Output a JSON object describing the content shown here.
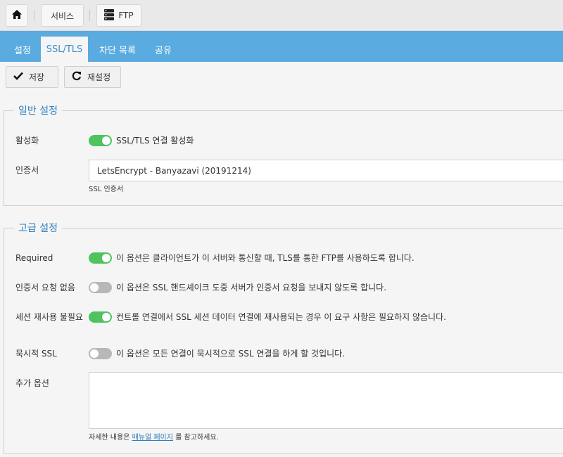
{
  "breadcrumb": {
    "services": "서비스",
    "ftp": "FTP"
  },
  "tabs": [
    "설정",
    "SSL/TLS",
    "차단 목록",
    "공유"
  ],
  "toolbar": {
    "save": "저장",
    "reset": "재설정"
  },
  "general": {
    "legend": "일반 설정",
    "enable_label": "활성화",
    "enable_text": "SSL/TLS 연결 활성화",
    "enable_on": true,
    "cert_label": "인증서",
    "cert_value": "LetsEncrypt - Banyazavi (20191214)",
    "cert_help": "SSL 인증서"
  },
  "advanced": {
    "legend": "고급 설정",
    "options": [
      {
        "label": "Required",
        "text": "이 옵션은 클라이언트가 이 서버와 통신할 때, TLS를 통한 FTP를 사용하도록 합니다.",
        "on": true
      },
      {
        "label": "인증서 요청 없음",
        "text": "이 옵션은 SSL 핸드셰이크 도중 서버가 인증서 요청을 보내지 않도록 합니다.",
        "on": false
      },
      {
        "label": "세션 재사용 불필요",
        "text": "컨트롤 연결에서 SSL 세션 데이터 연결에 재사용되는 경우 이 요구 사항은 필요하지 않습니다.",
        "on": true
      },
      {
        "label": "묵시적 SSL",
        "text": "이 옵션은 모든 연결이 묵시적으로 SSL 연결을 하게 할 것입니다.",
        "on": false
      }
    ],
    "extra_label": "추가 옵션",
    "help_before": "자세한 내용은",
    "help_link": "매뉴얼 페이지",
    "help_after": "를 참고하세요."
  },
  "colors": {
    "tabbar": "#5aabdf",
    "accent": "#2f7fbf",
    "toggle_on": "#4fc35f",
    "toggle_off": "#b8b8b8"
  }
}
